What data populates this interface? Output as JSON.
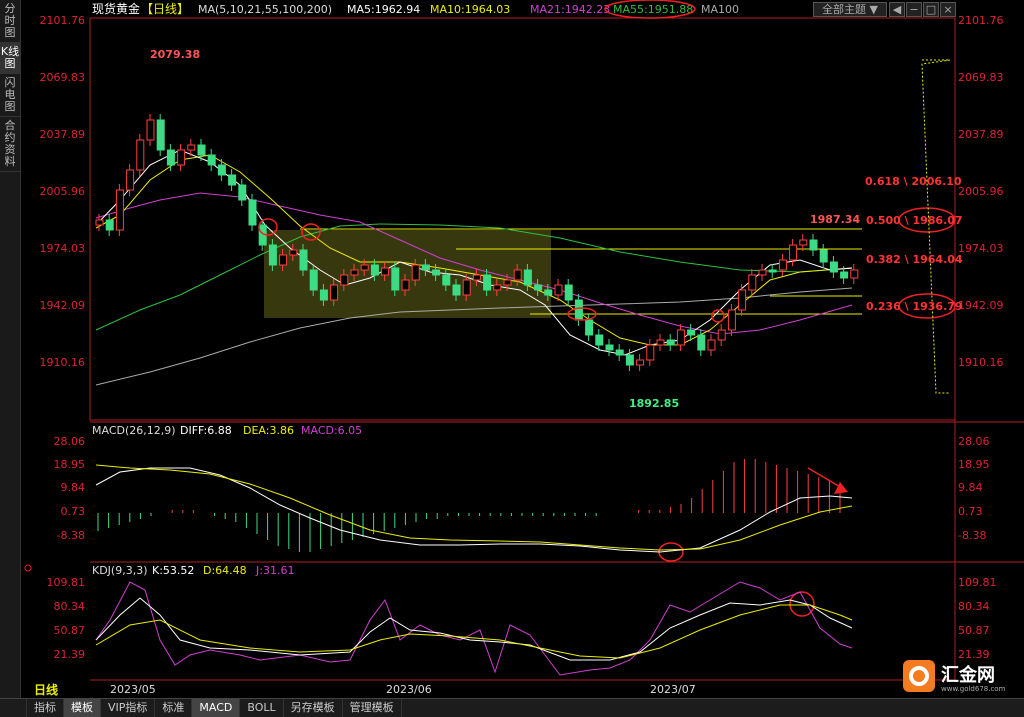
{
  "sidebar": {
    "items": [
      "分时图",
      "K线图",
      "闪电图",
      "合约资料"
    ]
  },
  "header": {
    "symbol": "现货黄金",
    "period": "【日线】",
    "ma_label": "MA(5,10,21,55,100,200)",
    "ma5": "MA5:1962.94",
    "ma10": "MA10:1964.03",
    "ma21": "MA21:1942.23",
    "ma55": "MA55:1951.88",
    "ma100": "MA100",
    "theme": "全部主题"
  },
  "price_axis": [
    "2101.76",
    "2069.83",
    "2037.89",
    "2005.96",
    "1974.03",
    "1942.09",
    "1910.16"
  ],
  "annotations": {
    "high": "2079.38",
    "low": "1892.85",
    "peak": "1987.34",
    "fib618": "0.618 \\ 2006.10",
    "fib500": "0.500 \\ 1986.07",
    "fib382": "0.382 \\ 1964.04",
    "fib236": "0.236 \\ 1936.79"
  },
  "macd": {
    "label": "MACD(26,12,9)",
    "diff": "DIFF:6.88",
    "dea": "DEA:3.86",
    "macd": "MACD:6.05",
    "axis": [
      "28.06",
      "18.95",
      "9.84",
      "0.73",
      "-8.38"
    ]
  },
  "kdj": {
    "label": "KDJ(9,3,3)",
    "k": "K:53.52",
    "d": "D:64.48",
    "j": "J:31.61",
    "axis": [
      "109.81",
      "80.34",
      "50.87",
      "21.39"
    ]
  },
  "dates": [
    "2023/05",
    "2023/06",
    "2023/07"
  ],
  "period_tab": "日线",
  "toolbar": [
    "指标",
    "模板",
    "VIP指标",
    "标准",
    "MACD",
    "BOLL",
    "另存模板",
    "管理模板"
  ],
  "logo": {
    "brand": "汇金网",
    "url": "www.gold678.com"
  },
  "colors": {
    "up": "#ff4040",
    "down": "#3ddc84",
    "ma5": "#ffffff",
    "ma10": "#e8e84a",
    "ma21": "#d040d0",
    "ma55": "#30c040",
    "ma100": "#aaaaaa",
    "axis": "#dd2222"
  },
  "chart_data": {
    "type": "candlestick",
    "ylim": [
      1885,
      2105
    ],
    "candles_sample": [
      {
        "date": "2023/05",
        "open": 2040,
        "high": 2079.38,
        "low": 2030,
        "close": 2050
      },
      {
        "date": "2023/06",
        "open": 1960,
        "high": 1975,
        "low": 1940,
        "close": 1945
      },
      {
        "date": "2023/06",
        "open": 1915,
        "high": 1925,
        "low": 1892.85,
        "close": 1918
      },
      {
        "date": "2023/07",
        "open": 1975,
        "high": 1987.34,
        "low": 1965,
        "close": 1970
      }
    ]
  }
}
